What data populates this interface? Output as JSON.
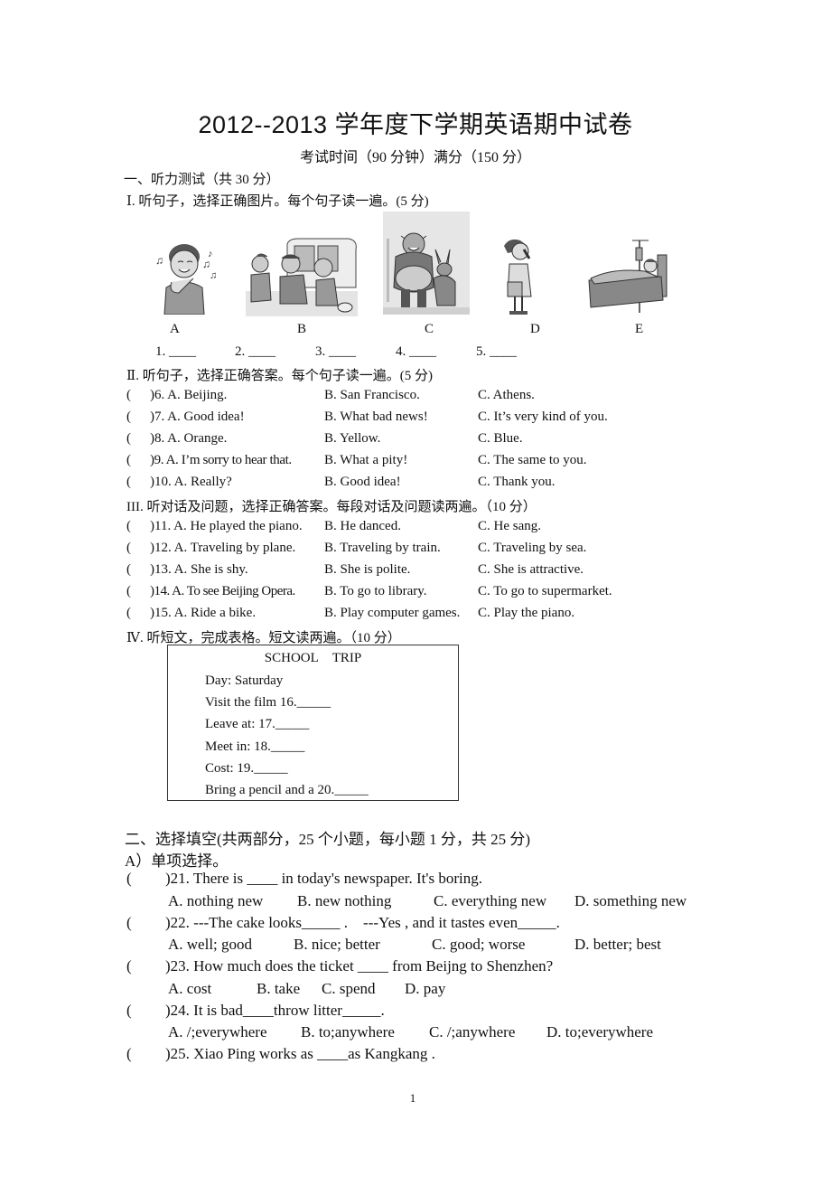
{
  "header": {
    "title": "2012--2013 学年度下学期英语期中试卷",
    "subtitle": "考试时间（90 分钟）满分（150 分）"
  },
  "part1": {
    "heading": "一、听力测试（共 30 分）",
    "section1": {
      "heading": "Ⅰ. 听句子，选择正确图片。每个句子读一遍。(5 分)",
      "pictures": [
        {
          "letter": "A",
          "icon": "boy-listening-music-icon"
        },
        {
          "letter": "B",
          "icon": "boys-accident-bus-icon"
        },
        {
          "letter": "C",
          "icon": "shrek-donkey-icon"
        },
        {
          "letter": "D",
          "icon": "girl-crying-icon"
        },
        {
          "letter": "E",
          "icon": "patient-in-bed-icon"
        }
      ],
      "blanks": [
        "1. ____",
        "2. ____",
        "3. ____",
        "4. ____",
        "5. ____"
      ]
    },
    "section2": {
      "heading": "Ⅱ. 听句子，选择正确答案。每个句子读一遍。(5 分)",
      "questions": [
        {
          "num": ")6. A. Beijing.",
          "b": "B. San Francisco.",
          "c": "C. Athens."
        },
        {
          "num": ")7. A. Good idea!",
          "b": "B. What bad news!",
          "c": "C. It’s very kind of you."
        },
        {
          "num": ")8. A. Orange.",
          "b": "B. Yellow.",
          "c": "C. Blue."
        },
        {
          "num": ")9. A. I’m sorry to hear that.",
          "b": "B. What a pity!",
          "c": "C. The same to you."
        },
        {
          "num": ")10. A. Really?",
          "b": "B. Good idea!",
          "c": "C. Thank you."
        }
      ]
    },
    "section3": {
      "heading": "III. 听对话及问题，选择正确答案。每段对话及问题读两遍。（10 分）",
      "questions": [
        {
          "num": ")11. A. He played the piano.",
          "b": "B. He danced.",
          "c": "C. He sang."
        },
        {
          "num": ")12. A. Traveling by plane.",
          "b": "B. Traveling by train.",
          "c": "C. Traveling by sea."
        },
        {
          "num": ")13. A. She is shy.",
          "b": "B. She is polite.",
          "c": "C. She is attractive."
        },
        {
          "num": ")14. A. To see Beijing Opera.",
          "b": "B. To go to library.",
          "c": "C. To go to supermarket."
        },
        {
          "num": ")15. A. Ride a bike.",
          "b": "B. Play computer games.",
          "c": "C. Play the piano."
        }
      ]
    },
    "section4": {
      "heading": "Ⅳ. 听短文，完成表格。短文读两遍。（10 分）",
      "table_title": "SCHOOL TRIP",
      "lines": [
        "Day: Saturday",
        "Visit the film 16._____",
        "Leave at: 17._____",
        "Meet in: 18._____",
        "Cost: 19._____",
        "Bring a pencil and a 20._____"
      ]
    }
  },
  "part2": {
    "heading": "二、选择填空(共两部分，25 个小题，每小题 1 分，共 25 分)",
    "subheading": "A）单项选择。",
    "paren": "(",
    "questions": [
      {
        "stem": ")21. There is ____ in today's newspaper. It's boring.",
        "options": [
          "A. nothing new",
          "B. new nothing",
          "C. everything new",
          "D. something new"
        ]
      },
      {
        "stem": ")22. ---The cake looks_____ .    ---Yes , and it tastes even_____.",
        "options": [
          "A. well; good",
          "B. nice; better",
          "C. good; worse",
          "D. better; best"
        ]
      },
      {
        "stem": ")23. How much does the ticket ____ from Beijng to Shenzhen?",
        "options": [
          "A. cost",
          "B. take",
          "C. spend",
          "D. pay"
        ]
      },
      {
        "stem": ")24. It is bad____throw litter_____.",
        "options": [
          "A. /;everywhere",
          "B. to;anywhere",
          "C. /;anywhere",
          "D. to;everywhere"
        ]
      },
      {
        "stem": ")25. Xiao Ping works as ____as Kangkang .",
        "options": []
      }
    ]
  },
  "footer": {
    "page_number": "1",
    "paren": "("
  }
}
